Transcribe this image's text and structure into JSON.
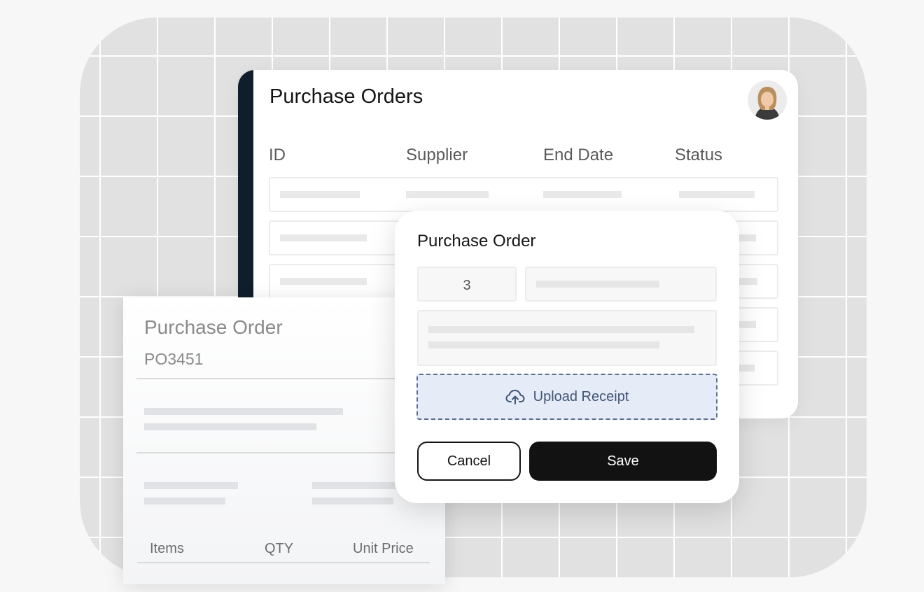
{
  "list": {
    "title": "Purchase Orders",
    "columns": [
      "ID",
      "Supplier",
      "End Date",
      "Status"
    ]
  },
  "document": {
    "title": "Purchase Order",
    "po_number": "PO3451",
    "columns": [
      "Items",
      "QTY",
      "Unit Price"
    ]
  },
  "modal": {
    "title": "Purchase Order",
    "quantity_value": "3",
    "upload_label": "Upload Receipt",
    "cancel_label": "Cancel",
    "save_label": "Save"
  },
  "icons": {
    "avatar": "user-avatar",
    "upload": "cloud-upload-icon"
  },
  "colors": {
    "rail": "#0f1e2c",
    "primary_button": "#121212",
    "upload_bg": "#e5ecf7",
    "upload_border": "#5d6c8f"
  }
}
